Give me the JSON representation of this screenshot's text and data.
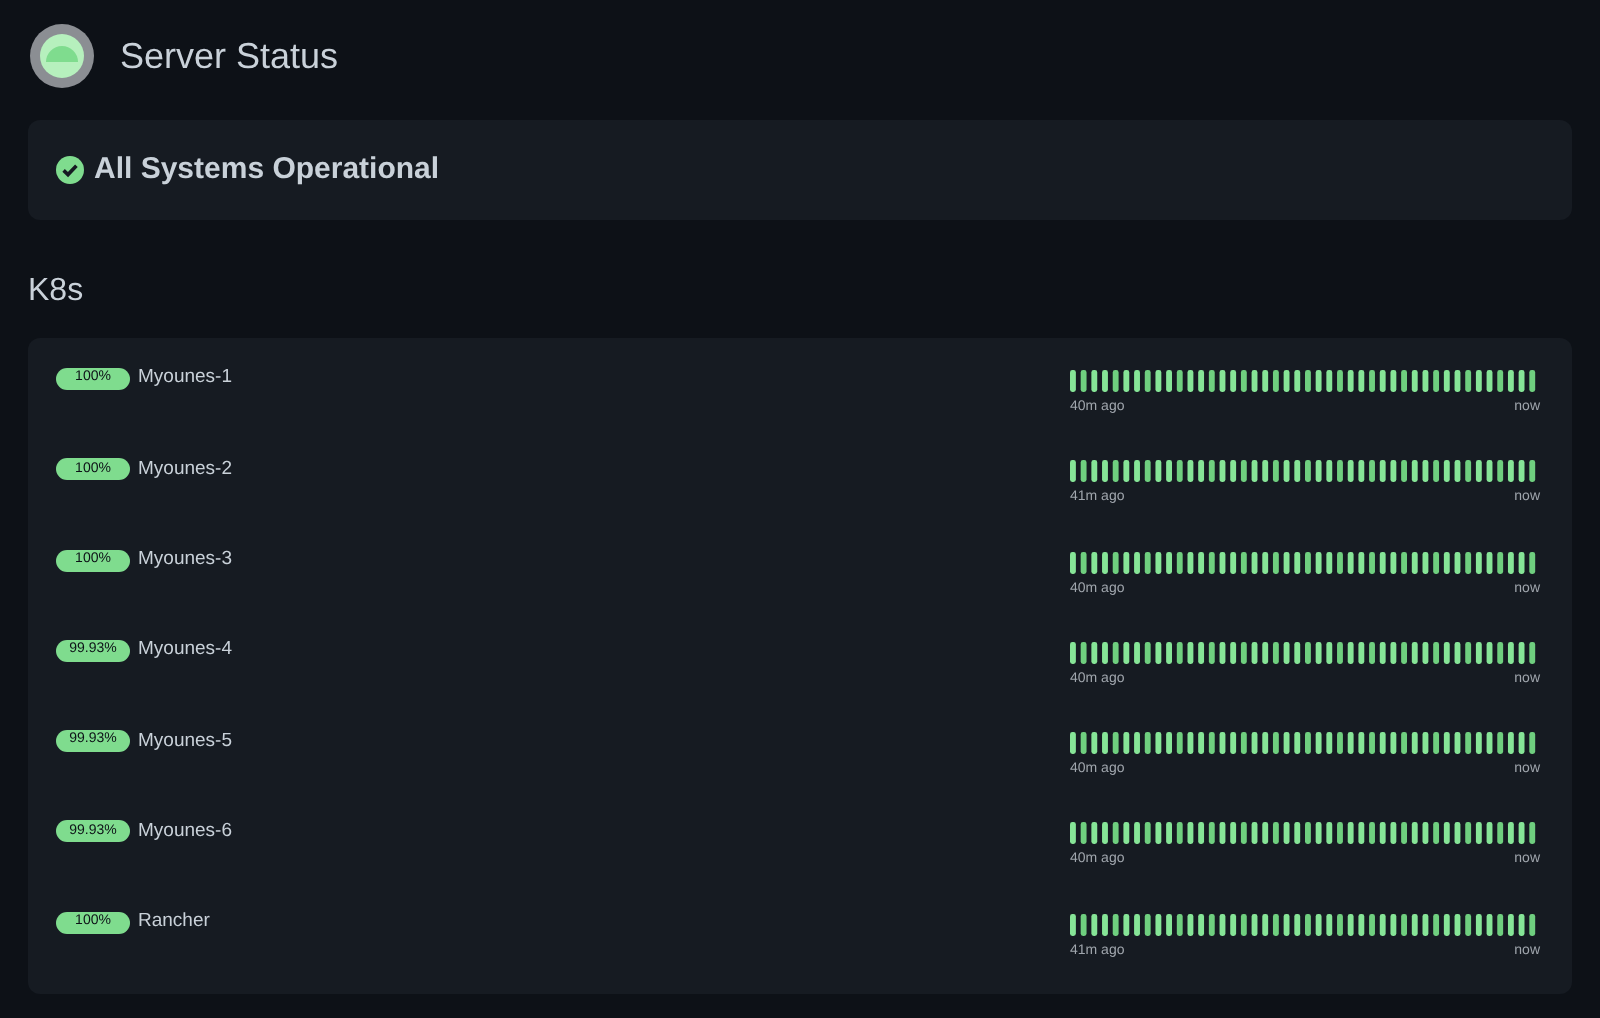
{
  "header": {
    "title": "Server Status"
  },
  "banner": {
    "text": "All Systems Operational"
  },
  "group": {
    "title": "K8s",
    "services": [
      {
        "uptime": "100%",
        "name": "Myounes-1",
        "start": "40m ago",
        "end": "now"
      },
      {
        "uptime": "100%",
        "name": "Myounes-2",
        "start": "41m ago",
        "end": "now"
      },
      {
        "uptime": "100%",
        "name": "Myounes-3",
        "start": "40m ago",
        "end": "now"
      },
      {
        "uptime": "99.93%",
        "name": "Myounes-4",
        "start": "40m ago",
        "end": "now"
      },
      {
        "uptime": "99.93%",
        "name": "Myounes-5",
        "start": "40m ago",
        "end": "now"
      },
      {
        "uptime": "99.93%",
        "name": "Myounes-6",
        "start": "40m ago",
        "end": "now"
      },
      {
        "uptime": "100%",
        "name": "Rancher",
        "start": "41m ago",
        "end": "now"
      }
    ]
  }
}
